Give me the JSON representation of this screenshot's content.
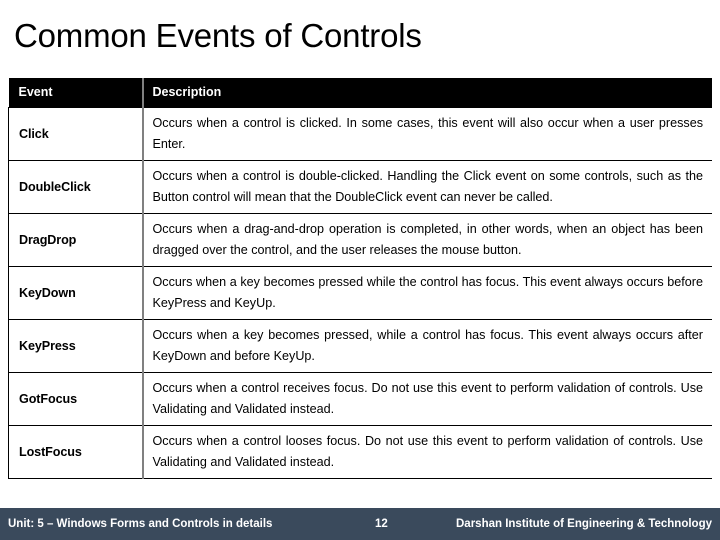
{
  "slide": {
    "title": "Common Events of Controls"
  },
  "table": {
    "headers": {
      "event": "Event",
      "description": "Description"
    },
    "rows": [
      {
        "event": "Click",
        "description": "Occurs when a control is clicked. In some cases, this event will also occur when a user presses Enter."
      },
      {
        "event": "DoubleClick",
        "description": "Occurs when a control is double-clicked. Handling the Click event on some controls, such as the Button control will mean that the DoubleClick event can never be called."
      },
      {
        "event": "DragDrop",
        "description": "Occurs when a drag-and-drop operation is completed, in other words, when an object has been dragged over the control, and the user releases the mouse button."
      },
      {
        "event": "KeyDown",
        "description": "Occurs when a key becomes pressed while the control has focus. This event always occurs before KeyPress and KeyUp."
      },
      {
        "event": "KeyPress",
        "description": "Occurs when a key becomes pressed, while a control has focus. This event always occurs after KeyDown and before KeyUp."
      },
      {
        "event": "GotFocus",
        "description": "Occurs when a control receives focus. Do not use this event to perform validation of controls. Use Validating and Validated instead."
      },
      {
        "event": "LostFocus",
        "description": "Occurs when a control looses focus. Do not use this event to perform validation of controls. Use Validating and Validated instead."
      }
    ]
  },
  "footer": {
    "unit": "Unit: 5 – Windows Forms and Controls in details",
    "page": "12",
    "institute": "Darshan Institute of Engineering & Technology",
    "background_color": "#3a4a5c",
    "text_color": "#ffffff"
  }
}
